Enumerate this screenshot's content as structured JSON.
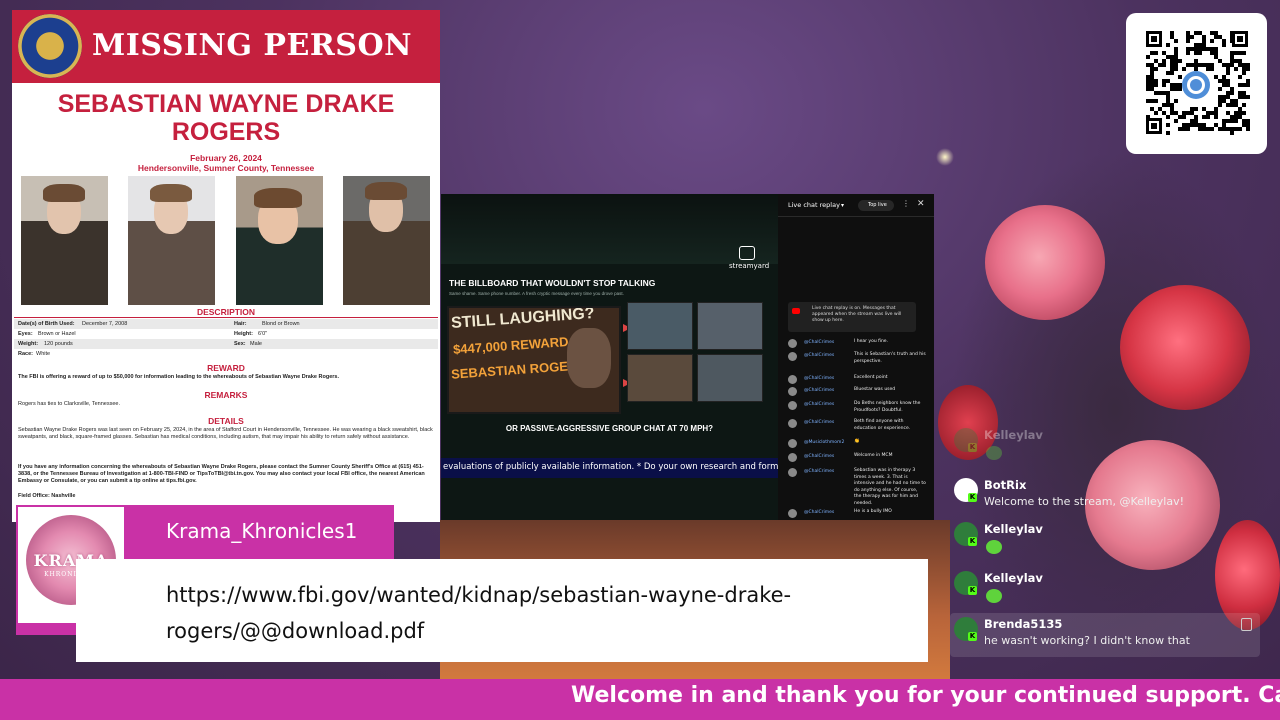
{
  "poster": {
    "banner_title": "MISSING PERSON",
    "name_line1": "SEBASTIAN WAYNE DRAKE",
    "name_line2": "ROGERS",
    "date": "February 26, 2024",
    "location": "Hendersonville, Sumner County, Tennessee",
    "description_head": "DESCRIPTION",
    "rows": [
      {
        "l_label": "Date(s) of Birth Used:",
        "l_val": "December 7, 2008",
        "r_label": "Hair:",
        "r_val": "Blond or Brown"
      },
      {
        "l_label": "Eyes:",
        "l_val": "Brown or Hazel",
        "r_label": "Height:",
        "r_val": "6'0\""
      },
      {
        "l_label": "Weight:",
        "l_val": "120 pounds",
        "r_label": "Sex:",
        "r_val": "Male"
      },
      {
        "l_label": "Race:",
        "l_val": "White",
        "r_label": "",
        "r_val": ""
      }
    ],
    "reward_head": "REWARD",
    "reward_text": "The FBI is offering a reward of up to $50,000 for information leading to the whereabouts of Sebastian Wayne Drake Rogers.",
    "remarks_head": "REMARKS",
    "remarks_text": "Rogers has ties to Clarksville, Tennessee.",
    "details_head": "DETAILS",
    "details_text": "Sebastian Wayne Drake Rogers was last seen on February 25, 2024, in the area of Stafford Court in Hendersonville, Tennessee. He was wearing a black sweatshirt, black sweatpants, and black, square-framed glasses. Sebastian has medical conditions, including autism, that may impair his ability to return safely without assistance.",
    "contact_text": "If you have any information concerning the whereabouts of Sebastian Wayne Drake Rogers, please contact the Sumner County Sheriff's Office at (615) 451-3838, or the Tennessee Bureau of Investigation at 1-800-TBI-FIND or TipsToTBI@tbi.tn.gov. You may also contact your local FBI office, the nearest American Embassy or Consulate, or you can submit a tip online at tips.fbi.gov.",
    "field_office": "Field Office: Nashville"
  },
  "video": {
    "brand": "streamyard",
    "kicker": "THE BILLBOARD THAT WOULDN'T STOP TALKING",
    "subtitle": "Same shame. Same phone number. A fresh cryptic message every time you drove past.",
    "billboard_line1": "STILL LAUGHING?",
    "billboard_line2": "$447,000 REWARD",
    "billboard_line3": "SEBASTIAN ROGERS",
    "caption": "OR PASSIVE-AGGRESSIVE GROUP CHAT AT 70 MPH?",
    "crawl": "evaluations of publicly available information. * Do your own research and form your own op"
  },
  "chat_replay": {
    "title": "Live chat replay",
    "filter": "Top live",
    "notice": "Live chat replay is on. Messages that appeared when the stream was live will show up here.",
    "messages": [
      {
        "user": "@ChalCrimes",
        "text": "I hear you fine."
      },
      {
        "user": "@ChalCrimes",
        "text": "This is Sebastian's truth and his perspective."
      },
      {
        "user": "@ChalCrimes",
        "text": "Excellent point"
      },
      {
        "user": "@ChalCrimes",
        "text": "Bluestar was used"
      },
      {
        "user": "@ChalCrimes",
        "text": "Do Beths neighbors know the Proudfoots? Doubtful."
      },
      {
        "user": "@ChalCrimes",
        "text": "Beth find anyone with education or experience."
      },
      {
        "user": "@Musiclothmom2",
        "text": "👏"
      },
      {
        "user": "@ChalCrimes",
        "text": "Welcome in MCM"
      },
      {
        "user": "@ChalCrimes",
        "text": "Sebastian was in therapy 3 times a week. 3. That is intensive and he had no time to do anything else. Of course, the therapy was for him and needed."
      },
      {
        "user": "@ChalCrimes",
        "text": "He is a bully IMO"
      }
    ]
  },
  "overlay_chat": [
    {
      "user": "Kelleylav",
      "text": "",
      "emote": true,
      "faded": true
    },
    {
      "user": "BotRix",
      "text": "Welcome to the stream, @Kelleylav!",
      "emote": false
    },
    {
      "user": "Kelleylav",
      "text": "",
      "emote": true
    },
    {
      "user": "Kelleylav",
      "text": "",
      "emote": true
    },
    {
      "user": "Brenda5135",
      "text": "he wasn't working? I didn't know that",
      "emote": false
    }
  ],
  "lower_third": {
    "channel_name": "Krama_Khronicles1",
    "logo_text": "KRAMA",
    "logo_sub": "KHRONICLES",
    "url_line1": "https://www.fbi.gov/wanted/kidnap/sebastian-wayne-drake-",
    "url_line2": "rogers/@@download.pdf"
  },
  "ticker": {
    "text": "Welcome in and thank you for your continued support. Cas"
  },
  "colors": {
    "fbi_red": "#c5203e",
    "brand_magenta": "#c931a6",
    "kick_green": "#53fc18"
  }
}
